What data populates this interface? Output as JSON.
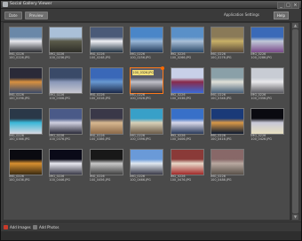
{
  "window": {
    "title": "Social Gallery Viewer",
    "controls": [
      "_",
      "□",
      "×"
    ]
  },
  "toolbar": {
    "tabs": [
      {
        "label": "Date"
      },
      {
        "label": "Preview"
      }
    ],
    "settings_label": "Application Settings",
    "help_label": "Help"
  },
  "thumbnails": [
    {
      "line1": "IMG_0226",
      "line2": "100_0226.JPG",
      "colors": [
        "#6a88a8",
        "#e8e8ee",
        "#2a2c30"
      ]
    },
    {
      "line1": "IMG_0226",
      "line2": "100_0236.JPG",
      "colors": [
        "#aac0d8",
        "#5a5a4a",
        "#2e2e28"
      ]
    },
    {
      "line1": "IMG_0226",
      "line2": "100_0248.JPG",
      "colors": [
        "#4a5a78",
        "#f0f0f4",
        "#203040"
      ]
    },
    {
      "line1": "IMG_0226",
      "line2": "100_0256.JPG",
      "colors": [
        "#4a86c8",
        "#9ab8d8",
        "#203858"
      ]
    },
    {
      "line1": "IMG_0226",
      "line2": "100_0266.JPG",
      "colors": [
        "#5a90c8",
        "#aac0d8",
        "#2a4868"
      ]
    },
    {
      "line1": "IMG_0226",
      "line2": "100_0276.JPG",
      "colors": [
        "#8a7a58",
        "#c8b068",
        "#5a4a38"
      ]
    },
    {
      "line1": "IMG_0226",
      "line2": "100_0286.JPG",
      "colors": [
        "#3a6ab8",
        "#c0c8d8",
        "#7a4a8a"
      ]
    },
    {
      "line1": "IMG_0226",
      "line2": "100_0296.JPG",
      "colors": [
        "#2a2a38",
        "#d89040",
        "#3a4a68"
      ]
    },
    {
      "line1": "IMG_0226",
      "line2": "100_0306.JPG",
      "colors": [
        "#3a4a68",
        "#8a98b8",
        "#c8c8d0"
      ]
    },
    {
      "line1": "IMG_0226",
      "line2": "100_0316.JPG",
      "colors": [
        "#3a68b8",
        "#6898d0",
        "#1a2848"
      ]
    },
    {
      "line1": "IMG_0226",
      "line2": "100_0326.JPG",
      "colors": [
        "#585a68",
        "#c0c0c8",
        "#303038"
      ],
      "selected": true,
      "badge": "100_0326.JPG"
    },
    {
      "line1": "IMG_0226",
      "line2": "100_0336.JPG",
      "colors": [
        "#c8d0e8",
        "#8a2a4a",
        "#3a6ad8"
      ]
    },
    {
      "line1": "IMG_0226",
      "line2": "100_0346.JPG",
      "colors": [
        "#8aa0a8",
        "#e0e0d8",
        "#486078"
      ]
    },
    {
      "line1": "IMG_0226",
      "line2": "100_0356.JPG",
      "colors": [
        "#c8ccd4",
        "#e8e8ea",
        "#5a5a60"
      ]
    },
    {
      "line1": "IMG_0226",
      "line2": "100_0366.JPG",
      "colors": [
        "#2a3848",
        "#3ab8d8",
        "#d8d8e0"
      ]
    },
    {
      "line1": "IMG_0226",
      "line2": "100_0376.JPG",
      "colors": [
        "#4a5a88",
        "#d0d0e0",
        "#2a2a38"
      ]
    },
    {
      "line1": "IMG_0226",
      "line2": "100_0386.JPG",
      "colors": [
        "#3a3848",
        "#d8b890",
        "#8a6848"
      ]
    },
    {
      "line1": "IMG_0226",
      "line2": "100_0396.JPG",
      "colors": [
        "#38a0c8",
        "#d8d0b8",
        "#6a5a48"
      ]
    },
    {
      "line1": "IMG_0226",
      "line2": "100_0406.JPG",
      "colors": [
        "#3870c8",
        "#d8d8e8",
        "#283858"
      ]
    },
    {
      "line1": "IMG_0226",
      "line2": "100_0416.JPG",
      "colors": [
        "#1a3a78",
        "#d89848",
        "#0a1830"
      ]
    },
    {
      "line1": "IMG_0226",
      "line2": "100_0426.JPG",
      "colors": [
        "#0a0a10",
        "#c8c8d8",
        "#e8e0c0"
      ]
    },
    {
      "line1": "IMG_0226",
      "line2": "100_0436.JPG",
      "colors": [
        "#0a0a10",
        "#d89030",
        "#3a2a10"
      ]
    },
    {
      "line1": "IMG_0226",
      "line2": "100_0446.JPG",
      "colors": [
        "#0a0a18",
        "#e8e8f0",
        "#3a3a48"
      ]
    },
    {
      "line1": "IMG_0226",
      "line2": "100_0456.JPG",
      "colors": [
        "#181818",
        "#c8c8c8",
        "#404040"
      ]
    },
    {
      "line1": "IMG_0226",
      "line2": "100_0466.JPG",
      "colors": [
        "#6a9ad8",
        "#e0e8f0",
        "#3a3a48"
      ]
    },
    {
      "line1": "IMG_0226",
      "line2": "100_0476.JPG",
      "colors": [
        "#8a3a38",
        "#e8d8c8",
        "#a02828"
      ]
    },
    {
      "line1": "IMG_0226",
      "line2": "100_0486.JPG",
      "colors": [
        "#886868",
        "#b8a8a0",
        "#585048"
      ]
    }
  ],
  "statusbar": {
    "add_images_label": "Add Images",
    "add_photos_label": "Add Photos"
  },
  "colors": {
    "accent": "#ff7a1a",
    "background": "#4a4a4a",
    "chrome": "#3a3a3a"
  }
}
